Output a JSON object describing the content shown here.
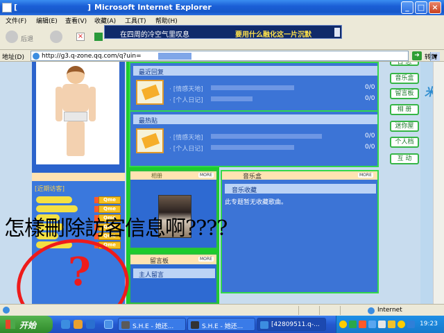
{
  "window": {
    "title_left": "[",
    "title_left_end": "]",
    "title": "Microsoft Internet Explorer"
  },
  "menu": [
    "文件(F)",
    "编辑(E)",
    "查看(V)",
    "收藏(A)",
    "工具(T)",
    "帮助(H)"
  ],
  "toolbar": {
    "back_label": "后退"
  },
  "banner": {
    "left_text": "在四周的冷空气里叹息",
    "right_text": "要用什么融化这一片沉默"
  },
  "address": {
    "label": "地址(D)",
    "url": "http://g3.q-zone.qq.com/q?uin=",
    "go_label": "转到"
  },
  "recent": {
    "header": "最近回复",
    "entries": [
      {
        "text": "· [情感天地]",
        "ratio": "0/0"
      },
      {
        "text": "· [个人日记]",
        "ratio": "0/0"
      }
    ]
  },
  "hot": {
    "header": "最热贴",
    "entries": [
      {
        "text": "· [情感天地]",
        "ratio": "0/0"
      },
      {
        "text": "· [个人日记]",
        "ratio": "0/0"
      }
    ]
  },
  "album": {
    "label": "相册",
    "more": "MORE"
  },
  "board": {
    "label": "留言板",
    "more": "MORE",
    "sub": "主人留言"
  },
  "music": {
    "label": "音乐盒",
    "more": "MORE",
    "sub": "音乐收藏",
    "empty": "此专题暂无收藏歌曲。"
  },
  "visitors": {
    "title": "[近期访客]",
    "qme_label": "Qme",
    "count": 6
  },
  "nav_tabs": [
    "音乐盒",
    "留言板",
    "相 册",
    "迷你屋",
    "个人档",
    "互 动"
  ],
  "nav_top": "日 志",
  "overlay": {
    "caption": "怎樣刪除訪客信息啊????",
    "mark": "?"
  },
  "status": {
    "zone": "Internet"
  },
  "taskbar": {
    "start": "开始",
    "tasks": [
      "S.H.E - 她还...",
      "S.H.E - 她还...",
      "[42809511.q-..."
    ],
    "clock": "19:23"
  },
  "colors": {
    "accent": "#2b63cc",
    "panel_border": "#33d84a",
    "annotation": "#ee1b1b"
  }
}
